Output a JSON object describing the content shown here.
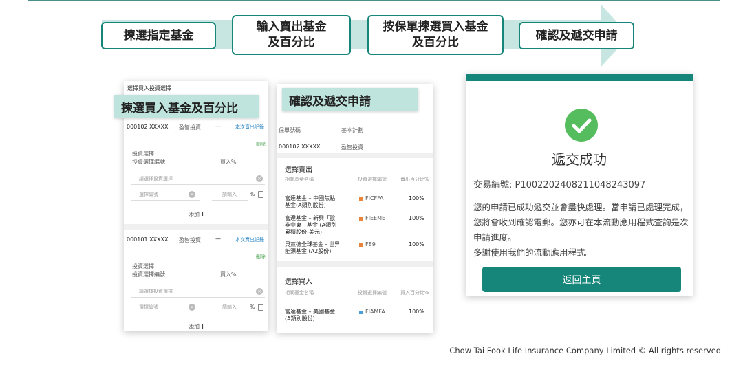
{
  "steps": [
    {
      "label": "揀選指定基金"
    },
    {
      "label": "輸入賣出基金\n及百分比"
    },
    {
      "label": "按保單揀選買入基金\n及百分比"
    },
    {
      "label": "確認及遞交申請"
    }
  ],
  "screen1": {
    "header": "選擇買入投資選擇",
    "banner": "揀選買入基金及百分比",
    "policies": [
      {
        "number": "000102 XXXXX",
        "plan": "盈智投資",
        "dash": "—",
        "link": "本次賣出記錄",
        "delete": "刪除",
        "section_label": "投資選擇",
        "code_label": "投資選擇編號",
        "percent_label": "買入%",
        "fund_placeholder": "請選擇投資選擇",
        "code_placeholder": "選擇編號",
        "percent_placeholder": "請輸入",
        "percent_sign": "%",
        "add": "添加",
        "add_icon": "+"
      },
      {
        "number": "000101 XXXXX",
        "plan": "盈智投資",
        "dash": "—",
        "link": "本次賣出記錄",
        "delete": "刪除",
        "section_label": "投資選擇",
        "code_label": "投資選擇編號",
        "percent_label": "買入%",
        "fund_placeholder": "請選擇投資選擇",
        "code_placeholder": "選擇編號",
        "percent_placeholder": "請輸入",
        "percent_sign": "%",
        "add": "添加",
        "add_icon": "+"
      }
    ]
  },
  "screen2": {
    "banner": "確認及遞交申請",
    "policy_label": "保單號碼",
    "plan_label": "基本計劃",
    "policy_number": "000102 XXXXX",
    "plan": "盈智投資",
    "sell": {
      "title": "選擇賣出",
      "headers": [
        "相關基金名稱",
        "投資選擇編號",
        "賣出百分比%"
      ],
      "rows": [
        {
          "name": "富達基金 – 中國焦點\n基金(A類別股份)",
          "code": "FICFFA",
          "pct": "100%",
          "color": "#e8853a"
        },
        {
          "name": "富達基金 – 新興「歐\n非中東」基金 (A類別\n累積股份-美元)",
          "code": "FIEEME",
          "pct": "100%",
          "color": "#e8853a"
        },
        {
          "name": "貝萊德全球基金 - 世界\n能源基金 (A2股份)",
          "code": "F89",
          "pct": "100%",
          "color": "#e8853a"
        }
      ]
    },
    "buy": {
      "title": "選擇買入",
      "headers": [
        "相關基金名稱",
        "投資選擇編號",
        "買入百分比%"
      ],
      "rows": [
        {
          "name": "富達基金 – 美國基金\n(A類別股份)",
          "code": "FIAMFA",
          "pct": "100%",
          "color": "#4a9fd8"
        }
      ]
    }
  },
  "success": {
    "title": "遞交成功",
    "txn": "交易編號: P1002202408211048243097",
    "message": "您的申請已成功遞交並會盡快處理。當申請已處理完成，您將會收到確認電郵。您亦可在本流動應用程式查詢是次申請進度。\n多謝使用我們的流動應用程式。",
    "button": "返回主頁",
    "accent": "#16857a",
    "check_color": "#56bd5e"
  },
  "footer": "Chow Tai Fook Life Insurance Company Limited © All rights reserved"
}
